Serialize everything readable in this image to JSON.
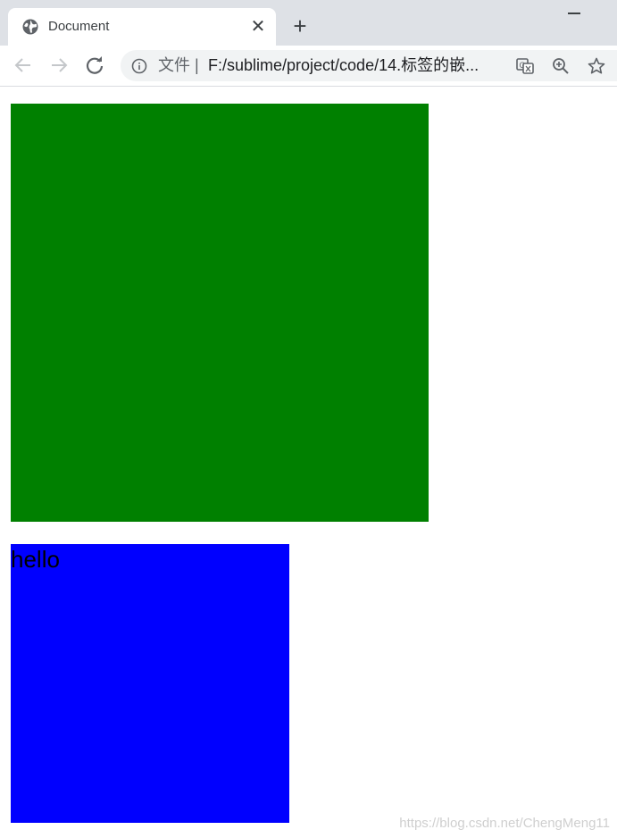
{
  "tab": {
    "title": "Document",
    "close_glyph": "✕",
    "favicon": "globe-icon"
  },
  "new_tab_glyph": "+",
  "toolbar": {
    "back_icon": "back-arrow-icon",
    "forward_icon": "forward-arrow-icon",
    "reload_icon": "reload-icon",
    "security_label": "文件 |",
    "url": "F:/sublime/project/code/14.标签的嵌...",
    "translate_icon": "translate-icon",
    "zoom_icon": "zoom-in-icon",
    "bookmark_icon": "star-icon"
  },
  "page": {
    "green_box_color": "#008000",
    "blue_box_color": "#0000ff",
    "blue_box_text": "hello"
  },
  "watermark": "https://blog.csdn.net/ChengMeng11"
}
